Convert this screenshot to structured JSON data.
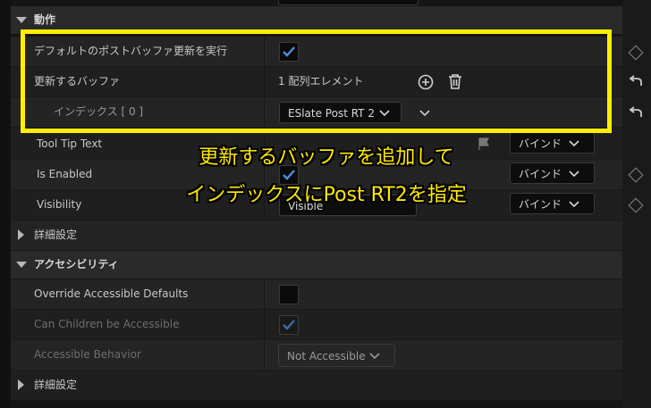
{
  "sections": {
    "behavior_title": "動作",
    "accessibility_title": "アクセシビリティ"
  },
  "behavior": {
    "run_default_post_buffer_update": {
      "label": "デフォルトのポストバッファ更新を実行",
      "checked": true
    },
    "buffers_to_update": {
      "label": "更新するバッファ",
      "value": "1 配列エレメント"
    },
    "index_row": {
      "label": "インデックス [ 0 ]",
      "value": "ESlate Post RT 2"
    }
  },
  "other_rows": {
    "tool_tip_text": {
      "label": "Tool Tip Text",
      "bind_label": "バインド"
    },
    "is_enabled": {
      "label": "Is Enabled",
      "bind_label": "バインド",
      "checked": true
    },
    "visibility": {
      "label": "Visibility",
      "value": "Visible",
      "bind_label": "バインド"
    },
    "advanced_1": "詳細設定"
  },
  "accessibility": {
    "override_accessible_defaults": {
      "label": "Override Accessible Defaults",
      "checked": false
    },
    "can_children_be_accessible": {
      "label": "Can Children be Accessible",
      "checked": true
    },
    "accessible_behavior": {
      "label": "Accessible Behavior",
      "value": "Not Accessible"
    },
    "advanced_2": "詳細設定"
  },
  "annotation": {
    "line1": "更新するバッファを追加して",
    "line2": "インデックスにPost RT2を指定"
  },
  "colors": {
    "highlight": "#ffee00",
    "check_blue": "#4a90e2"
  }
}
